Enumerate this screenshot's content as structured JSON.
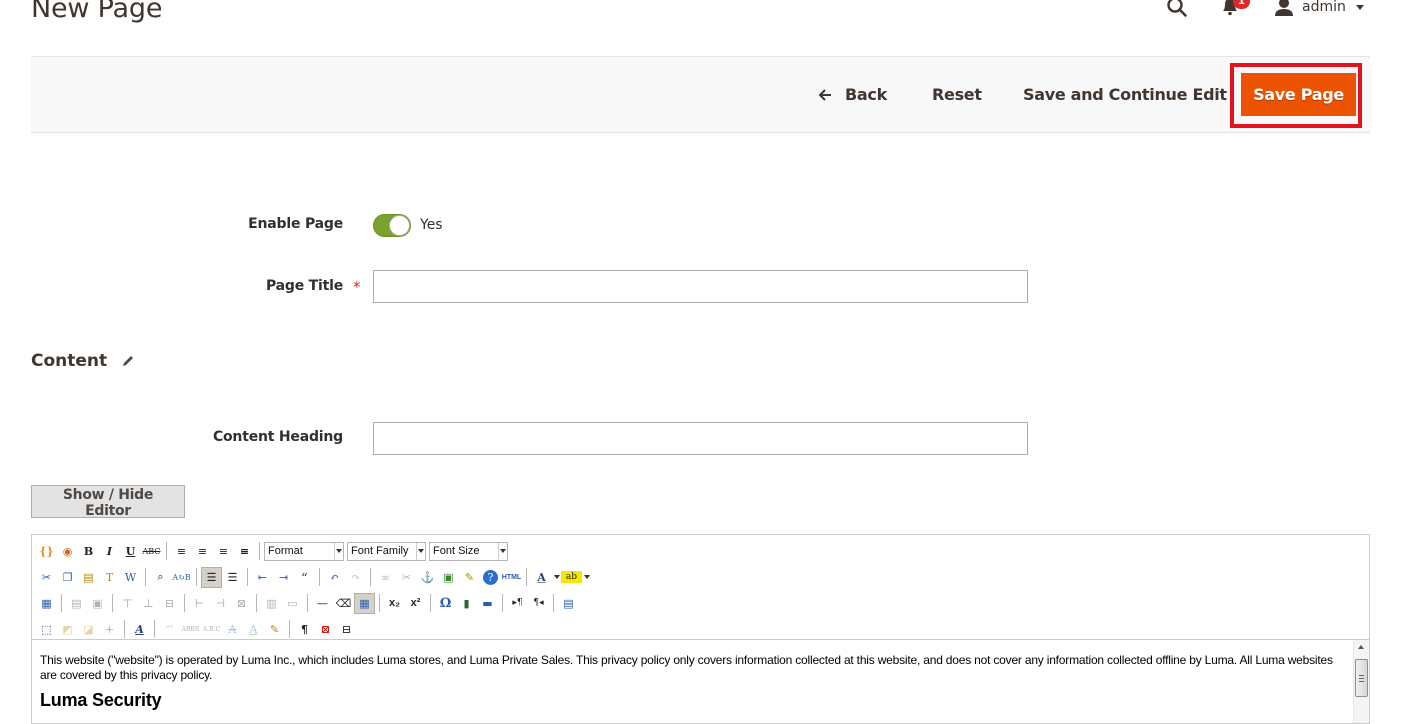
{
  "header": {
    "title": "New Page",
    "notifications_count": "1",
    "user_name": "admin"
  },
  "actions": {
    "back_label": "Back",
    "reset_label": "Reset",
    "save_continue_label": "Save and Continue Edit",
    "save_page_label": "Save Page",
    "accent_color": "#eb5202",
    "highlight_color": "#e3121e"
  },
  "form": {
    "enable_page": {
      "label": "Enable Page",
      "value": "Yes",
      "enabled": true
    },
    "page_title": {
      "label": "Page Title",
      "required_mark": "*",
      "value": ""
    },
    "content_section": {
      "title": "Content"
    },
    "content_heading": {
      "label": "Content Heading",
      "value": ""
    },
    "show_hide_editor_label": "Show / Hide Editor"
  },
  "editor": {
    "toolbar": {
      "format_select": "Format",
      "font_family_select": "Font Family",
      "font_size_select": "Font Size",
      "row1": [
        "magento-widget",
        "magento-variable",
        "bold",
        "italic",
        "underline",
        "strikethrough",
        "align-left",
        "align-center",
        "align-right",
        "align-justify"
      ],
      "row2": [
        "cut",
        "copy",
        "paste",
        "paste-text",
        "paste-word",
        "find",
        "replace",
        "bullet-list",
        "numbered-list",
        "outdent",
        "indent",
        "blockquote",
        "undo",
        "redo",
        "link",
        "unlink",
        "anchor",
        "image",
        "cleanup",
        "help",
        "html",
        "text-color",
        "background-color"
      ],
      "row3": [
        "table",
        "row-props",
        "cell-props",
        "insert-row-before",
        "insert-row-after",
        "delete-row",
        "insert-col-before",
        "insert-col-after",
        "delete-col",
        "split-cells",
        "merge-cells",
        "horizontal-rule",
        "remove-format",
        "visual-aid",
        "subscript",
        "superscript",
        "special-char",
        "media",
        "advanced-hr",
        "ltr",
        "rtl",
        "fullscreen"
      ],
      "row4": [
        "insert-layer",
        "move-forward",
        "move-backward",
        "absolute",
        "styles",
        "cite",
        "abbreviation",
        "acronym",
        "deletion",
        "insertion",
        "attributes",
        "visual-chars",
        "nonbreaking",
        "page-break"
      ],
      "text_color_glyph": "A",
      "bg_color_glyph": "ab",
      "html_glyph": "HTML",
      "special_char_glyph": "Ω",
      "pilcrow_glyph": "¶"
    },
    "content": {
      "paragraph": "This website (\"website\") is operated by Luma Inc., which includes Luma stores, and Luma Private Sales. This privacy policy only covers information collected at this website, and does not cover any information collected offline by Luma. All Luma websites are covered by this privacy policy.",
      "heading": "Luma Security"
    }
  }
}
